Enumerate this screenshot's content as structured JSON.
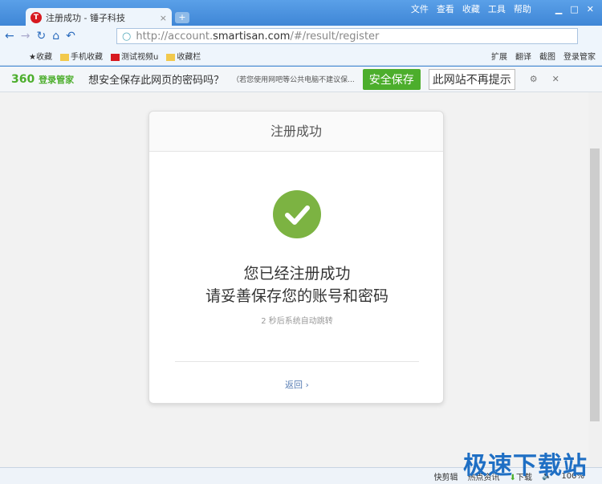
{
  "tab": {
    "title": "注册成功 - 锤子科技",
    "logo": "T"
  },
  "menu": [
    "文件",
    "查看",
    "收藏",
    "工具",
    "帮助"
  ],
  "address": {
    "prefix": "http://account.",
    "domain": "smartisan.com",
    "suffix": "/#/result/register"
  },
  "bookmarks": [
    "收藏",
    "手机收藏",
    "测试视频u",
    "收藏栏"
  ],
  "bookmarks_right": [
    "扩展",
    "翻译",
    "截图",
    "登录管家"
  ],
  "password_bar": {
    "brand": "360",
    "brand_label": "登录管家",
    "question": "想安全保存此网页的密码吗？",
    "note": "（若您使用网吧等公共电脑不建议保...",
    "save": "安全保存",
    "never": "此网站不再提示"
  },
  "card": {
    "title": "注册成功",
    "line1": "您已经注册成功",
    "line2": "请妥善保存您的账号和密码",
    "redirect": "2 秒后系统自动跳转",
    "back": "返回 ›"
  },
  "status": {
    "items": [
      "快剪辑",
      "热点资讯",
      "下载"
    ],
    "zoom": "100%"
  },
  "watermark": "极速下载站",
  "colors": {
    "success": "#7cb342",
    "save_button": "#4cae2c"
  }
}
